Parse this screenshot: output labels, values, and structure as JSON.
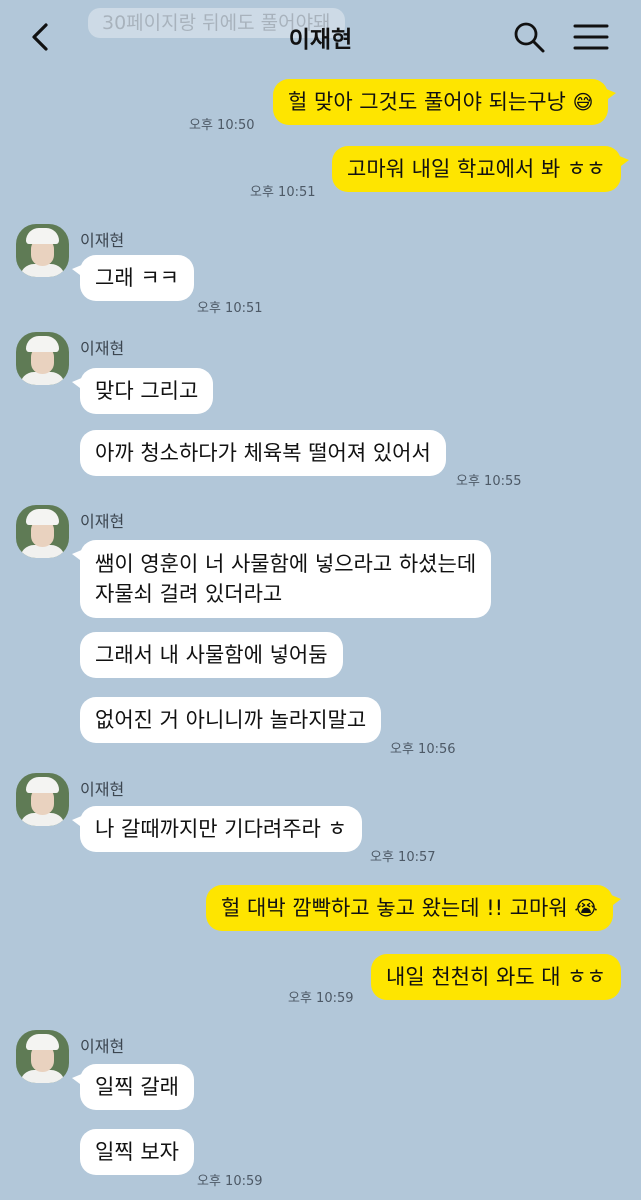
{
  "header": {
    "title": "이재현",
    "ghost_text": "30페이지랑 뒤에도 풀어야돼"
  },
  "contact_name": "이재현",
  "messages": {
    "m1": {
      "text": "헐 맞아 그것도 풀어야 되는구낭",
      "emoji": "😅",
      "time": "오후 10:50"
    },
    "m2": {
      "text": "고마워 내일 학교에서 봐 ㅎㅎ",
      "time": "오후 10:51"
    },
    "m3": {
      "text": "그래 ㅋㅋ",
      "time": "오후 10:51"
    },
    "m4": {
      "text": "맞다 그리고"
    },
    "m5": {
      "text": "아까 청소하다가 체육복 떨어져 있어서",
      "time": "오후 10:55"
    },
    "m6": {
      "line1": "쌤이 영훈이 너 사물함에 넣으라고 하셨는데",
      "line2": "자물쇠 걸려 있더라고"
    },
    "m7": {
      "text": "그래서 내 사물함에 넣어둠"
    },
    "m8": {
      "text": "없어진 거 아니니까 놀라지말고",
      "time": "오후 10:56"
    },
    "m9": {
      "text": "나 갈때까지만 기다려주라 ㅎ",
      "time": "오후 10:57"
    },
    "m10": {
      "text": "헐 대박 깜빡하고 놓고 왔는데 !! 고마워",
      "emoji": "😭"
    },
    "m11": {
      "text": "내일 천천히 와도 대 ㅎㅎ",
      "time": "오후 10:59"
    },
    "m12": {
      "text": "일찍 갈래"
    },
    "m13": {
      "text": "일찍 보자",
      "time": "오후 10:59"
    }
  },
  "colors": {
    "background": "#b2c7d9",
    "my_bubble": "#fee500",
    "other_bubble": "#ffffff"
  },
  "icons": [
    "chevron-left-icon",
    "search-icon",
    "menu-icon"
  ]
}
